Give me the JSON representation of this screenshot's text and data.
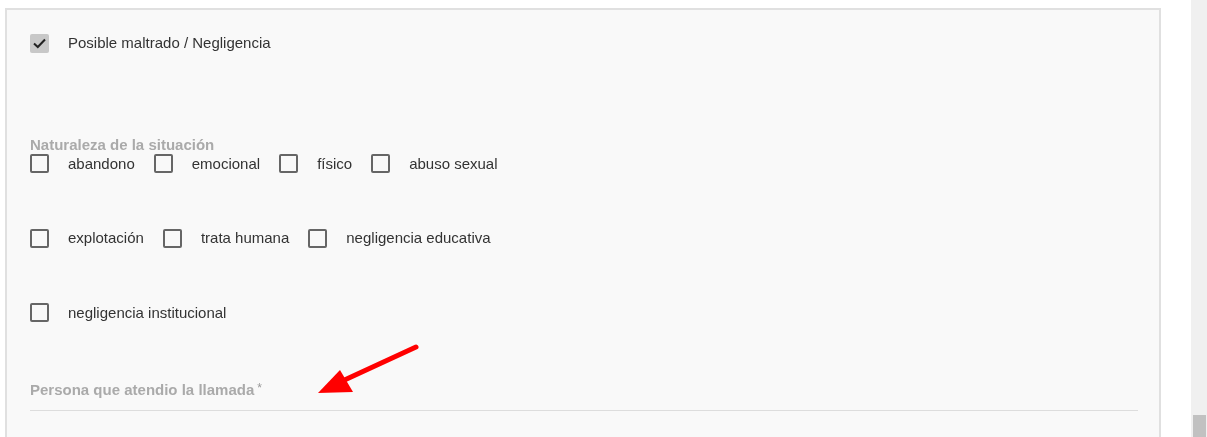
{
  "main_checkbox": {
    "label": "Posible maltrado / Negligencia",
    "checked": true
  },
  "nature": {
    "label": "Naturaleza de la situación",
    "rows": [
      [
        {
          "label": "abandono",
          "checked": false
        },
        {
          "label": "emocional",
          "checked": false
        },
        {
          "label": "físico",
          "checked": false
        },
        {
          "label": "abuso sexual",
          "checked": false
        }
      ],
      [
        {
          "label": "explotación",
          "checked": false
        },
        {
          "label": "trata humana",
          "checked": false
        },
        {
          "label": "negligencia educativa",
          "checked": false
        }
      ],
      [
        {
          "label": "negligencia institucional",
          "checked": false
        }
      ]
    ]
  },
  "attendant_field": {
    "label": "Persona que atendio la llamada",
    "required_mark": "*"
  }
}
